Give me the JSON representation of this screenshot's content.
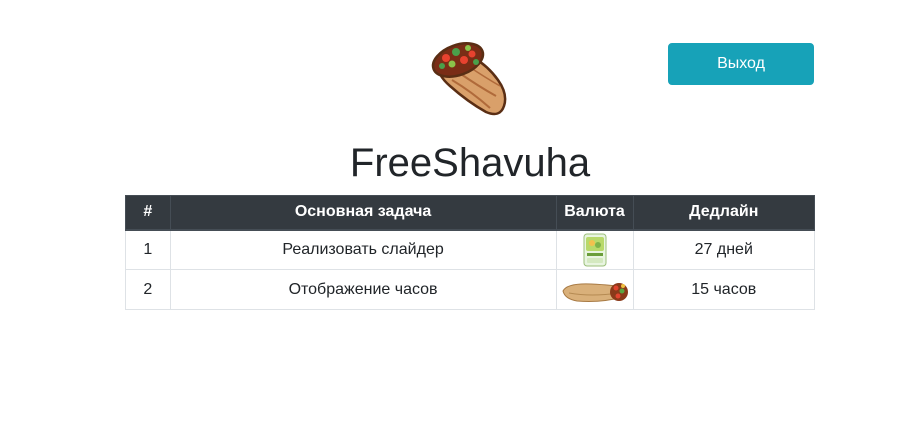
{
  "header": {
    "logo_icon": "shawarma-icon",
    "logout_label": "Выход",
    "title": "FreeShavuha"
  },
  "colors": {
    "logout_button": "#17a2b8",
    "table_header_bg": "#343a40",
    "text": "#212529"
  },
  "table": {
    "columns": [
      "#",
      "Основная задача",
      "Валюта",
      "Дедлайн"
    ],
    "rows": [
      {
        "num": "1",
        "task": "Реализовать слайдер",
        "currency_icon": "salad-pack-icon",
        "deadline": "27 дней"
      },
      {
        "num": "2",
        "task": "Отображение часов",
        "currency_icon": "shawarma-roll-icon",
        "deadline": "15 часов"
      }
    ]
  }
}
